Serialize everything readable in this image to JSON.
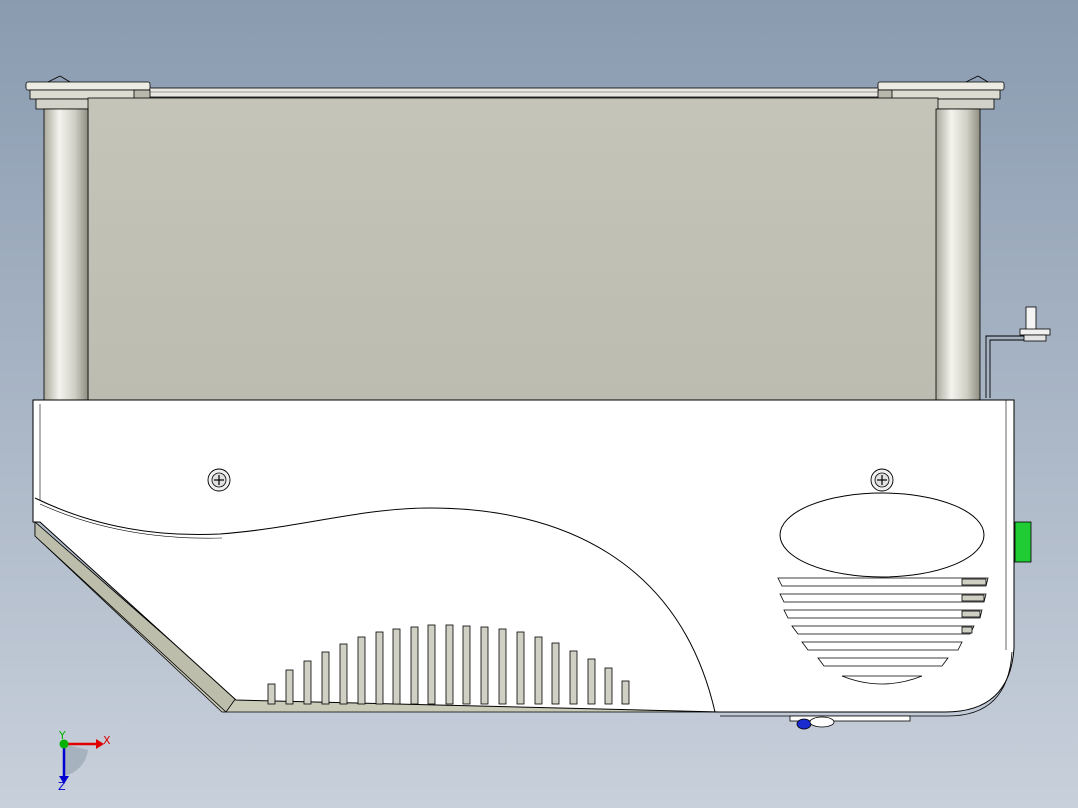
{
  "viewport": {
    "background_top": "#8a9bb0",
    "background_bottom": "#c8d0db"
  },
  "model": {
    "body_color": "#ffffff",
    "panel_color": "#c0c0b4",
    "pillar_color": "#d8d8cf",
    "base_strip_color": "#d6d6c6",
    "indicator_color": "#1fcc33",
    "edge_color": "#000000"
  },
  "triad": {
    "x_label": "X",
    "y_label": "Y",
    "z_label": "Z",
    "x_color": "#e00000",
    "y_color": "#00b000",
    "z_color": "#0000d0"
  }
}
